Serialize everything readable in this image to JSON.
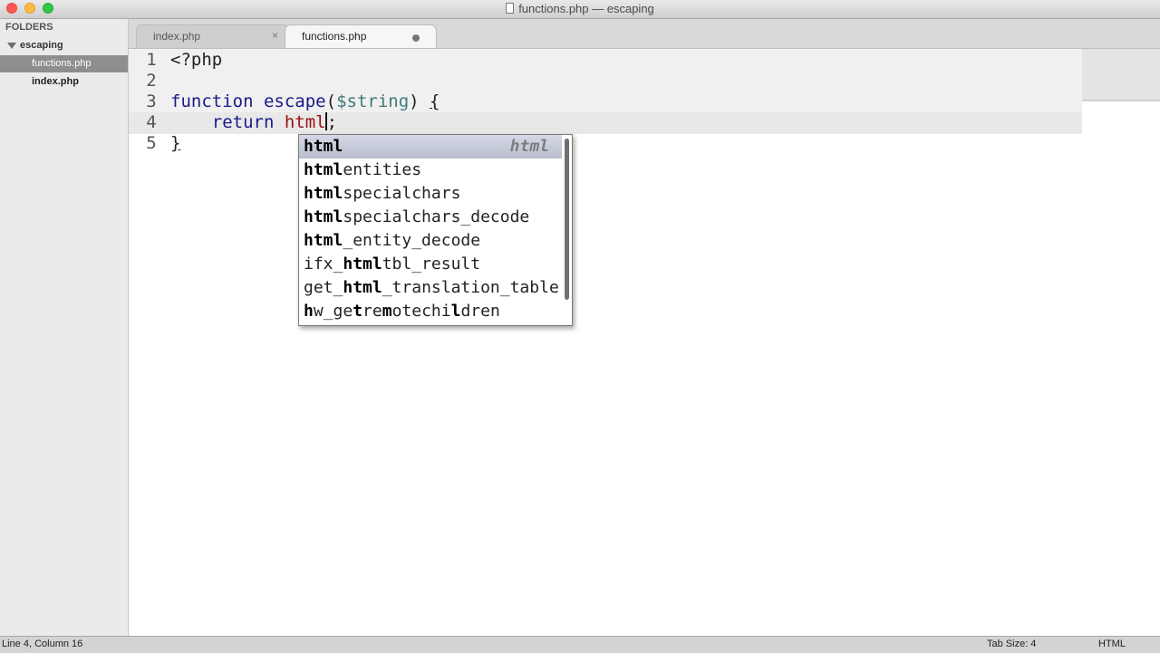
{
  "window": {
    "title": "functions.php — escaping",
    "controls": [
      "close",
      "minimize",
      "maximize"
    ]
  },
  "sidebar": {
    "header": "FOLDERS",
    "folder": "escaping",
    "files": [
      {
        "label": "functions.php",
        "selected": true
      },
      {
        "label": "index.php",
        "selected": false
      }
    ]
  },
  "tabs": [
    {
      "label": "index.php",
      "active": false,
      "close_glyph": "×"
    },
    {
      "label": "functions.php",
      "active": true,
      "modified": true
    }
  ],
  "editor": {
    "line_numbers": [
      "1",
      "2",
      "3",
      "4",
      "5"
    ],
    "lines": [
      {
        "text": "<?php"
      },
      {
        "text": ""
      },
      {
        "keyword": "function",
        "name": "escape",
        "open_paren": "(",
        "param": "$string",
        "close_paren": ")",
        "brace": "{"
      },
      {
        "keyword": "return",
        "typed": "html",
        "after": ";"
      },
      {
        "text": "}"
      }
    ],
    "current_line": 4
  },
  "autocomplete": {
    "items": [
      {
        "parts": [
          {
            "t": "html",
            "b": true
          }
        ],
        "hint": "html",
        "selected": true
      },
      {
        "parts": [
          {
            "t": "html",
            "b": true
          },
          {
            "t": "entities",
            "b": false
          }
        ]
      },
      {
        "parts": [
          {
            "t": "html",
            "b": true
          },
          {
            "t": "specialchars",
            "b": false
          }
        ]
      },
      {
        "parts": [
          {
            "t": "html",
            "b": true
          },
          {
            "t": "specialchars_decode",
            "b": false
          }
        ]
      },
      {
        "parts": [
          {
            "t": "html",
            "b": true
          },
          {
            "t": "_entity_decode",
            "b": false
          }
        ]
      },
      {
        "parts": [
          {
            "t": "ifx_",
            "b": false
          },
          {
            "t": "html",
            "b": true
          },
          {
            "t": "tbl_result",
            "b": false
          }
        ]
      },
      {
        "parts": [
          {
            "t": "get_",
            "b": false
          },
          {
            "t": "html",
            "b": true
          },
          {
            "t": "_translation_table",
            "b": false
          }
        ]
      },
      {
        "parts": [
          {
            "t": "h",
            "b": true
          },
          {
            "t": "w_ge",
            "b": false
          },
          {
            "t": "t",
            "b": true
          },
          {
            "t": "re",
            "b": false
          },
          {
            "t": "m",
            "b": true
          },
          {
            "t": "otechi",
            "b": false
          },
          {
            "t": "l",
            "b": true
          },
          {
            "t": "dren",
            "b": false
          }
        ]
      }
    ]
  },
  "statusbar": {
    "position": "Line 4, Column 16",
    "tab_size": "Tab Size: 4",
    "syntax": "HTML"
  },
  "colors": {
    "keyword": "#1a1a8a",
    "variable": "#3d7a7a",
    "typed": "#9a1010",
    "sidebar_selected": "#8e8e8e"
  }
}
